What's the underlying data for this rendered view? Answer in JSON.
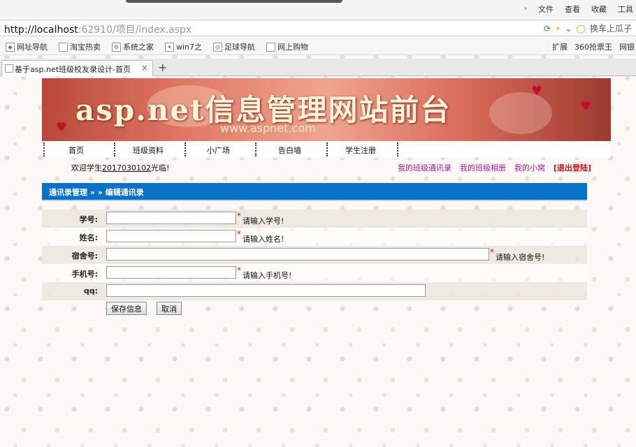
{
  "browser": {
    "menu": [
      "文件",
      "查看",
      "收藏",
      "工具"
    ],
    "url_host": "http://localhost",
    "url_rest": ":62910/项目/index.aspx",
    "search_placeholder": "换车上瓜子",
    "bookmarks": [
      "网址导航",
      "淘宝热卖",
      "系统之家",
      "win7之",
      "足球导航",
      "网上购物"
    ],
    "right_bookmarks": [
      "扩展",
      "360抢票王",
      "网银"
    ],
    "tab_title": "基于asp.net班级校友录设计-首页",
    "tab_close": "×",
    "new_tab": "+"
  },
  "banner": {
    "title": "asp.net信息管理网站前台",
    "subtitle": "www.aspnet.com"
  },
  "nav": {
    "items": [
      "首页",
      "班级资料",
      "小广场",
      "告白墙",
      "学生注册"
    ]
  },
  "user": {
    "welcome_prefix": "欢迎学生",
    "student_id": "2017030102",
    "welcome_suffix": "光临!",
    "links": [
      "我的班级通讯录",
      "我的班级相册",
      "我的小窝"
    ],
    "logout": "[退出登陆]"
  },
  "section": {
    "title": "通讯录管理 » » 编辑通讯录"
  },
  "form": {
    "fields": [
      {
        "label": "学号:",
        "value": "",
        "required": "*",
        "hint": "请输入学号!"
      },
      {
        "label": "姓名:",
        "value": "",
        "required": "*",
        "hint": "请输入姓名!"
      },
      {
        "label": "宿舍号:",
        "value": "",
        "required": "*",
        "hint": "请输入宿舍号!"
      },
      {
        "label": "手机号:",
        "value": "",
        "required": "*",
        "hint": "请输入手机号!"
      },
      {
        "label": "qq:",
        "value": ""
      }
    ],
    "save_label": "保存信息",
    "cancel_label": "取消"
  }
}
